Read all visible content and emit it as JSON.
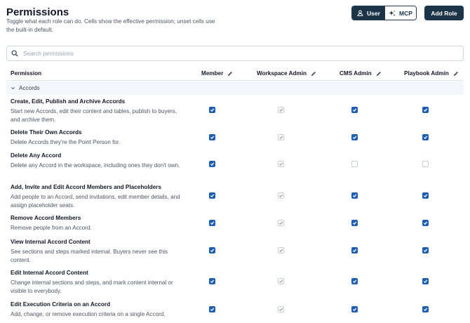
{
  "header": {
    "title": "Permissions",
    "subtitle": "Toggle what each role can do. Cells show the effective permission; unset cells use the built-in default.",
    "user_button": "User",
    "mcp_button": "MCP",
    "add_role_button": "Add Role"
  },
  "search": {
    "placeholder": "Search permissions"
  },
  "table": {
    "columns": [
      "Permission",
      "Member",
      "Workspace Admin",
      "CMS Admin",
      "Playbook Admin"
    ],
    "section": "Accords",
    "rows": [
      {
        "name": "Create, Edit, Publish and Archive Accords",
        "description": "Start new Accords, edit their content and tables, publish to buyers, and archive them.",
        "member": "checked",
        "workspace_admin": "inherited",
        "cms_admin": "checked",
        "playbook_admin": "checked"
      },
      {
        "name": "Delete Their Own Accords",
        "description": "Delete Accords they're the Point Person for.",
        "member": "checked",
        "workspace_admin": "inherited",
        "cms_admin": "checked",
        "playbook_admin": "checked"
      },
      {
        "name": "Delete Any Accord",
        "description": "Delete any Accord in the workspace, including ones they don't own.",
        "member": "checked",
        "workspace_admin": "inherited",
        "cms_admin": "unchecked",
        "playbook_admin": "unchecked"
      },
      {
        "name": "Add, Invite and Edit Accord Members and Placeholders",
        "description": "Add people to an Accord, send invitations, edit member details, and assign placeholder seats.",
        "member": "checked",
        "workspace_admin": "inherited",
        "cms_admin": "checked",
        "playbook_admin": "checked"
      },
      {
        "name": "Remove Accord Members",
        "description": "Remove people from an Accord.",
        "member": "checked",
        "workspace_admin": "inherited",
        "cms_admin": "checked",
        "playbook_admin": "checked"
      },
      {
        "name": "View Internal Accord Content",
        "description": "See sections and steps marked internal. Buyers never see this content.",
        "member": "checked",
        "workspace_admin": "inherited",
        "cms_admin": "checked",
        "playbook_admin": "checked"
      },
      {
        "name": "Edit Internal Accord Content",
        "description": "Change internal sections and steps, and mark content internal or visible to everybody.",
        "member": "checked",
        "workspace_admin": "inherited",
        "cms_admin": "checked",
        "playbook_admin": "checked"
      },
      {
        "name": "Edit Execution Criteria on an Accord",
        "description": "Add, change, or remove execution criteria on a single Accord.",
        "member": "checked",
        "workspace_admin": "inherited",
        "cms_admin": "checked",
        "playbook_admin": "checked"
      }
    ]
  },
  "colors": {
    "primary": "#1b3448",
    "checkbox_on": "#1e5fb4",
    "section_bg": "#f3f6fa"
  }
}
